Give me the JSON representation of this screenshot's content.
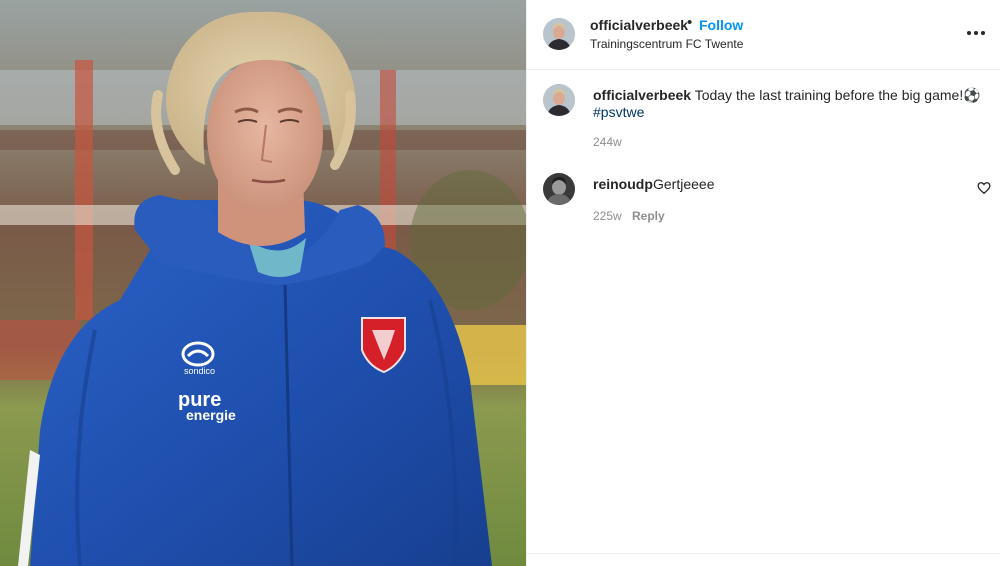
{
  "post": {
    "media": {
      "alt_description": "",
      "jacket_logo": "sondico",
      "jacket_sponsor_line1": "pure",
      "jacket_sponsor_line2": "energie"
    },
    "header": {
      "username": "officialverbeek",
      "separator": "•",
      "follow_label": "Follow",
      "location": "Trainingscentrum FC Twente",
      "more_icon": "more-horizontal-icon"
    },
    "caption": {
      "username": "officialverbeek",
      "text": "Today the last training before the big game!⚽",
      "hashtag": "#psvtwe",
      "time": "244w"
    },
    "comments": [
      {
        "username": "reinoudp",
        "text": "Gertjeeee",
        "time": "225w",
        "reply_label": "Reply",
        "like_icon": "heart-outline-icon"
      }
    ]
  },
  "colors": {
    "follow": "#0095f6",
    "hashtag": "#00376b",
    "muted": "#8e8e8e",
    "jacket": "#1f4fae"
  }
}
